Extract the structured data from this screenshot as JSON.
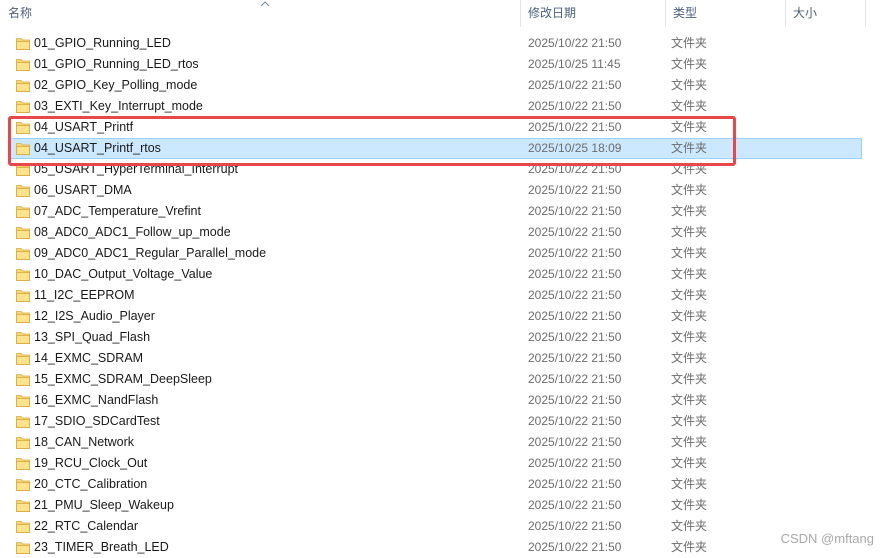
{
  "header": {
    "name_label": "名称",
    "date_label": "修改日期",
    "type_label": "类型",
    "size_label": "大小"
  },
  "files": [
    {
      "name": "01_GPIO_Running_LED",
      "date": "2025/10/22 21:50",
      "type": "文件夹"
    },
    {
      "name": "01_GPIO_Running_LED_rtos",
      "date": "2025/10/25 11:45",
      "type": "文件夹"
    },
    {
      "name": "02_GPIO_Key_Polling_mode",
      "date": "2025/10/22 21:50",
      "type": "文件夹"
    },
    {
      "name": "03_EXTI_Key_Interrupt_mode",
      "date": "2025/10/22 21:50",
      "type": "文件夹"
    },
    {
      "name": "04_USART_Printf",
      "date": "2025/10/22 21:50",
      "type": "文件夹"
    },
    {
      "name": "04_USART_Printf_rtos",
      "date": "2025/10/25 18:09",
      "type": "文件夹",
      "selected": true
    },
    {
      "name": "05_USART_HyperTerminal_Interrupt",
      "date": "2025/10/22 21:50",
      "type": "文件夹"
    },
    {
      "name": "06_USART_DMA",
      "date": "2025/10/22 21:50",
      "type": "文件夹"
    },
    {
      "name": "07_ADC_Temperature_Vrefint",
      "date": "2025/10/22 21:50",
      "type": "文件夹"
    },
    {
      "name": "08_ADC0_ADC1_Follow_up_mode",
      "date": "2025/10/22 21:50",
      "type": "文件夹"
    },
    {
      "name": "09_ADC0_ADC1_Regular_Parallel_mode",
      "date": "2025/10/22 21:50",
      "type": "文件夹"
    },
    {
      "name": "10_DAC_Output_Voltage_Value",
      "date": "2025/10/22 21:50",
      "type": "文件夹"
    },
    {
      "name": "11_I2C_EEPROM",
      "date": "2025/10/22 21:50",
      "type": "文件夹"
    },
    {
      "name": "12_I2S_Audio_Player",
      "date": "2025/10/22 21:50",
      "type": "文件夹"
    },
    {
      "name": "13_SPI_Quad_Flash",
      "date": "2025/10/22 21:50",
      "type": "文件夹"
    },
    {
      "name": "14_EXMC_SDRAM",
      "date": "2025/10/22 21:50",
      "type": "文件夹"
    },
    {
      "name": "15_EXMC_SDRAM_DeepSleep",
      "date": "2025/10/22 21:50",
      "type": "文件夹"
    },
    {
      "name": "16_EXMC_NandFlash",
      "date": "2025/10/22 21:50",
      "type": "文件夹"
    },
    {
      "name": "17_SDIO_SDCardTest",
      "date": "2025/10/22 21:50",
      "type": "文件夹"
    },
    {
      "name": "18_CAN_Network",
      "date": "2025/10/22 21:50",
      "type": "文件夹"
    },
    {
      "name": "19_RCU_Clock_Out",
      "date": "2025/10/22 21:50",
      "type": "文件夹"
    },
    {
      "name": "20_CTC_Calibration",
      "date": "2025/10/22 21:50",
      "type": "文件夹"
    },
    {
      "name": "21_PMU_Sleep_Wakeup",
      "date": "2025/10/22 21:50",
      "type": "文件夹"
    },
    {
      "name": "22_RTC_Calendar",
      "date": "2025/10/22 21:50",
      "type": "文件夹"
    },
    {
      "name": "23_TIMER_Breath_LED",
      "date": "2025/10/22 21:50",
      "type": "文件夹"
    }
  ],
  "watermark": "CSDN @mftang",
  "colors": {
    "folder": "#f8d775",
    "selection": "#cce8ff",
    "highlight_border": "#e8484a"
  },
  "icons": {
    "folder": "folder-icon",
    "sort": "sort-up-arrow-icon"
  }
}
